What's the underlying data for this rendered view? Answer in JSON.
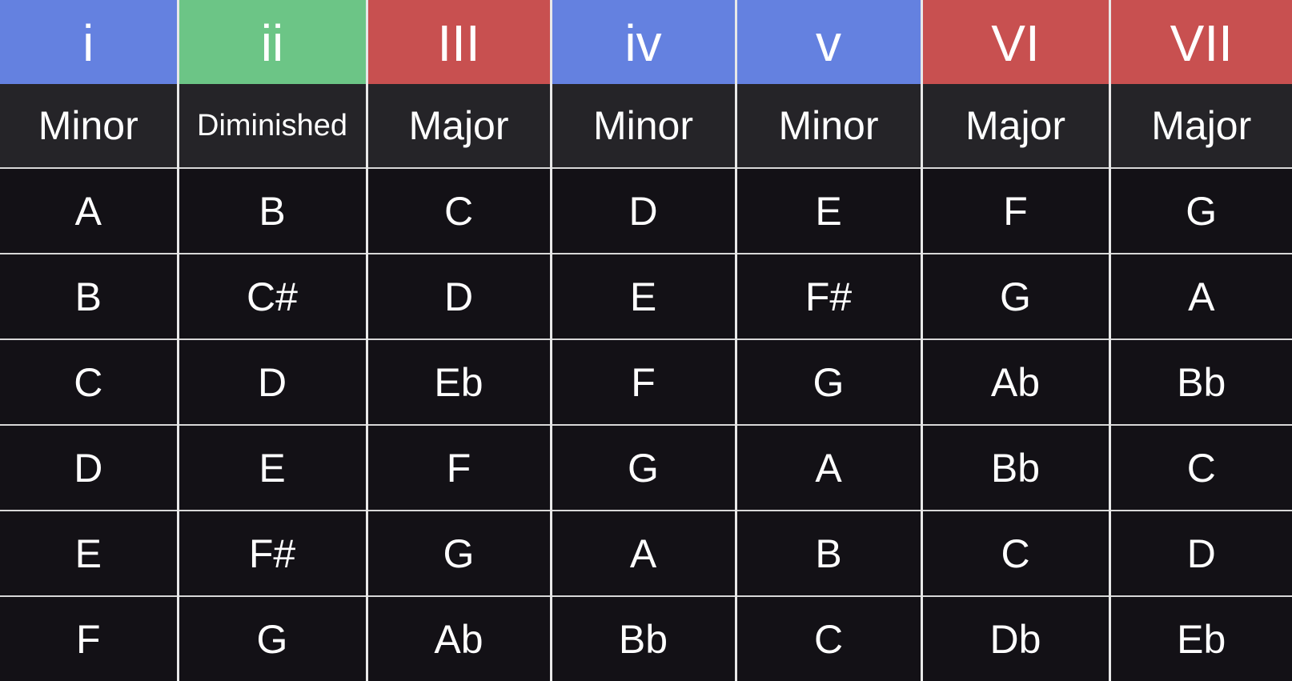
{
  "colors": {
    "minor": "#6481e0",
    "diminished": "#6cc586",
    "major": "#c85050"
  },
  "columns": [
    {
      "numeral": "i",
      "quality": "Minor",
      "color": "#6481e0"
    },
    {
      "numeral": "ii",
      "quality": "Diminished",
      "color": "#6cc586"
    },
    {
      "numeral": "III",
      "quality": "Major",
      "color": "#c85050"
    },
    {
      "numeral": "iv",
      "quality": "Minor",
      "color": "#6481e0"
    },
    {
      "numeral": "v",
      "quality": "Minor",
      "color": "#6481e0"
    },
    {
      "numeral": "VI",
      "quality": "Major",
      "color": "#c85050"
    },
    {
      "numeral": "VII",
      "quality": "Major",
      "color": "#c85050"
    }
  ],
  "rows": [
    [
      "A",
      "B",
      "C",
      "D",
      "E",
      "F",
      "G"
    ],
    [
      "B",
      "C#",
      "D",
      "E",
      "F#",
      "G",
      "A"
    ],
    [
      "C",
      "D",
      "Eb",
      "F",
      "G",
      "Ab",
      "Bb"
    ],
    [
      "D",
      "E",
      "F",
      "G",
      "A",
      "Bb",
      "C"
    ],
    [
      "E",
      "F#",
      "G",
      "A",
      "B",
      "C",
      "D"
    ],
    [
      "F",
      "G",
      "Ab",
      "Bb",
      "C",
      "Db",
      "Eb"
    ]
  ]
}
